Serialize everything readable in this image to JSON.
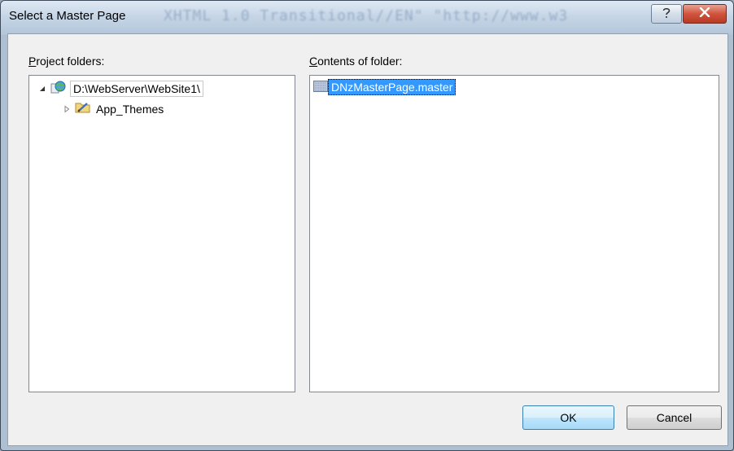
{
  "window": {
    "title": "Select a Master Page",
    "background_text": "XHTML 1.0 Transitional//EN\" \"http://www.w3",
    "help_icon": "question-mark-icon",
    "close_icon": "close-x-icon"
  },
  "project_folders": {
    "label_prefix": "P",
    "label_rest": "roject folders:",
    "tree": [
      {
        "label": "D:\\WebServer\\WebSite1\\",
        "icon": "web-project-icon",
        "expanded": true
      },
      {
        "label": "App_Themes",
        "icon": "themes-folder-icon",
        "expanded": false
      }
    ]
  },
  "contents": {
    "label_prefix": "C",
    "label_rest": "ontents of folder:",
    "files": [
      {
        "label": "DNzMasterPage.master",
        "icon": "master-page-file-icon",
        "selected": true
      }
    ]
  },
  "buttons": {
    "ok": "OK",
    "cancel": "Cancel"
  },
  "colors": {
    "selection": "#3399ff",
    "close_button": "#c9442f"
  }
}
